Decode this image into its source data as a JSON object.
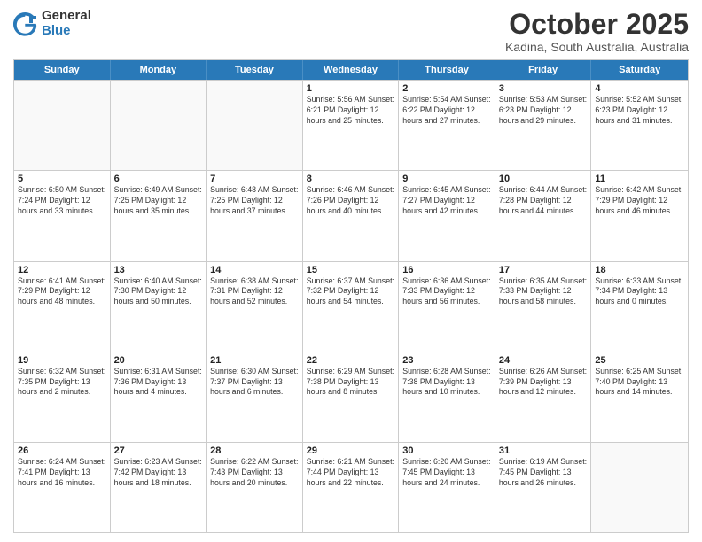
{
  "header": {
    "logo_general": "General",
    "logo_blue": "Blue",
    "title": "October 2025",
    "subtitle": "Kadina, South Australia, Australia"
  },
  "days": [
    "Sunday",
    "Monday",
    "Tuesday",
    "Wednesday",
    "Thursday",
    "Friday",
    "Saturday"
  ],
  "weeks": [
    [
      {
        "day": "",
        "info": ""
      },
      {
        "day": "",
        "info": ""
      },
      {
        "day": "",
        "info": ""
      },
      {
        "day": "1",
        "info": "Sunrise: 5:56 AM\nSunset: 6:21 PM\nDaylight: 12 hours\nand 25 minutes."
      },
      {
        "day": "2",
        "info": "Sunrise: 5:54 AM\nSunset: 6:22 PM\nDaylight: 12 hours\nand 27 minutes."
      },
      {
        "day": "3",
        "info": "Sunrise: 5:53 AM\nSunset: 6:23 PM\nDaylight: 12 hours\nand 29 minutes."
      },
      {
        "day": "4",
        "info": "Sunrise: 5:52 AM\nSunset: 6:23 PM\nDaylight: 12 hours\nand 31 minutes."
      }
    ],
    [
      {
        "day": "5",
        "info": "Sunrise: 6:50 AM\nSunset: 7:24 PM\nDaylight: 12 hours\nand 33 minutes."
      },
      {
        "day": "6",
        "info": "Sunrise: 6:49 AM\nSunset: 7:25 PM\nDaylight: 12 hours\nand 35 minutes."
      },
      {
        "day": "7",
        "info": "Sunrise: 6:48 AM\nSunset: 7:25 PM\nDaylight: 12 hours\nand 37 minutes."
      },
      {
        "day": "8",
        "info": "Sunrise: 6:46 AM\nSunset: 7:26 PM\nDaylight: 12 hours\nand 40 minutes."
      },
      {
        "day": "9",
        "info": "Sunrise: 6:45 AM\nSunset: 7:27 PM\nDaylight: 12 hours\nand 42 minutes."
      },
      {
        "day": "10",
        "info": "Sunrise: 6:44 AM\nSunset: 7:28 PM\nDaylight: 12 hours\nand 44 minutes."
      },
      {
        "day": "11",
        "info": "Sunrise: 6:42 AM\nSunset: 7:29 PM\nDaylight: 12 hours\nand 46 minutes."
      }
    ],
    [
      {
        "day": "12",
        "info": "Sunrise: 6:41 AM\nSunset: 7:29 PM\nDaylight: 12 hours\nand 48 minutes."
      },
      {
        "day": "13",
        "info": "Sunrise: 6:40 AM\nSunset: 7:30 PM\nDaylight: 12 hours\nand 50 minutes."
      },
      {
        "day": "14",
        "info": "Sunrise: 6:38 AM\nSunset: 7:31 PM\nDaylight: 12 hours\nand 52 minutes."
      },
      {
        "day": "15",
        "info": "Sunrise: 6:37 AM\nSunset: 7:32 PM\nDaylight: 12 hours\nand 54 minutes."
      },
      {
        "day": "16",
        "info": "Sunrise: 6:36 AM\nSunset: 7:33 PM\nDaylight: 12 hours\nand 56 minutes."
      },
      {
        "day": "17",
        "info": "Sunrise: 6:35 AM\nSunset: 7:33 PM\nDaylight: 12 hours\nand 58 minutes."
      },
      {
        "day": "18",
        "info": "Sunrise: 6:33 AM\nSunset: 7:34 PM\nDaylight: 13 hours\nand 0 minutes."
      }
    ],
    [
      {
        "day": "19",
        "info": "Sunrise: 6:32 AM\nSunset: 7:35 PM\nDaylight: 13 hours\nand 2 minutes."
      },
      {
        "day": "20",
        "info": "Sunrise: 6:31 AM\nSunset: 7:36 PM\nDaylight: 13 hours\nand 4 minutes."
      },
      {
        "day": "21",
        "info": "Sunrise: 6:30 AM\nSunset: 7:37 PM\nDaylight: 13 hours\nand 6 minutes."
      },
      {
        "day": "22",
        "info": "Sunrise: 6:29 AM\nSunset: 7:38 PM\nDaylight: 13 hours\nand 8 minutes."
      },
      {
        "day": "23",
        "info": "Sunrise: 6:28 AM\nSunset: 7:38 PM\nDaylight: 13 hours\nand 10 minutes."
      },
      {
        "day": "24",
        "info": "Sunrise: 6:26 AM\nSunset: 7:39 PM\nDaylight: 13 hours\nand 12 minutes."
      },
      {
        "day": "25",
        "info": "Sunrise: 6:25 AM\nSunset: 7:40 PM\nDaylight: 13 hours\nand 14 minutes."
      }
    ],
    [
      {
        "day": "26",
        "info": "Sunrise: 6:24 AM\nSunset: 7:41 PM\nDaylight: 13 hours\nand 16 minutes."
      },
      {
        "day": "27",
        "info": "Sunrise: 6:23 AM\nSunset: 7:42 PM\nDaylight: 13 hours\nand 18 minutes."
      },
      {
        "day": "28",
        "info": "Sunrise: 6:22 AM\nSunset: 7:43 PM\nDaylight: 13 hours\nand 20 minutes."
      },
      {
        "day": "29",
        "info": "Sunrise: 6:21 AM\nSunset: 7:44 PM\nDaylight: 13 hours\nand 22 minutes."
      },
      {
        "day": "30",
        "info": "Sunrise: 6:20 AM\nSunset: 7:45 PM\nDaylight: 13 hours\nand 24 minutes."
      },
      {
        "day": "31",
        "info": "Sunrise: 6:19 AM\nSunset: 7:45 PM\nDaylight: 13 hours\nand 26 minutes."
      },
      {
        "day": "",
        "info": ""
      }
    ]
  ]
}
